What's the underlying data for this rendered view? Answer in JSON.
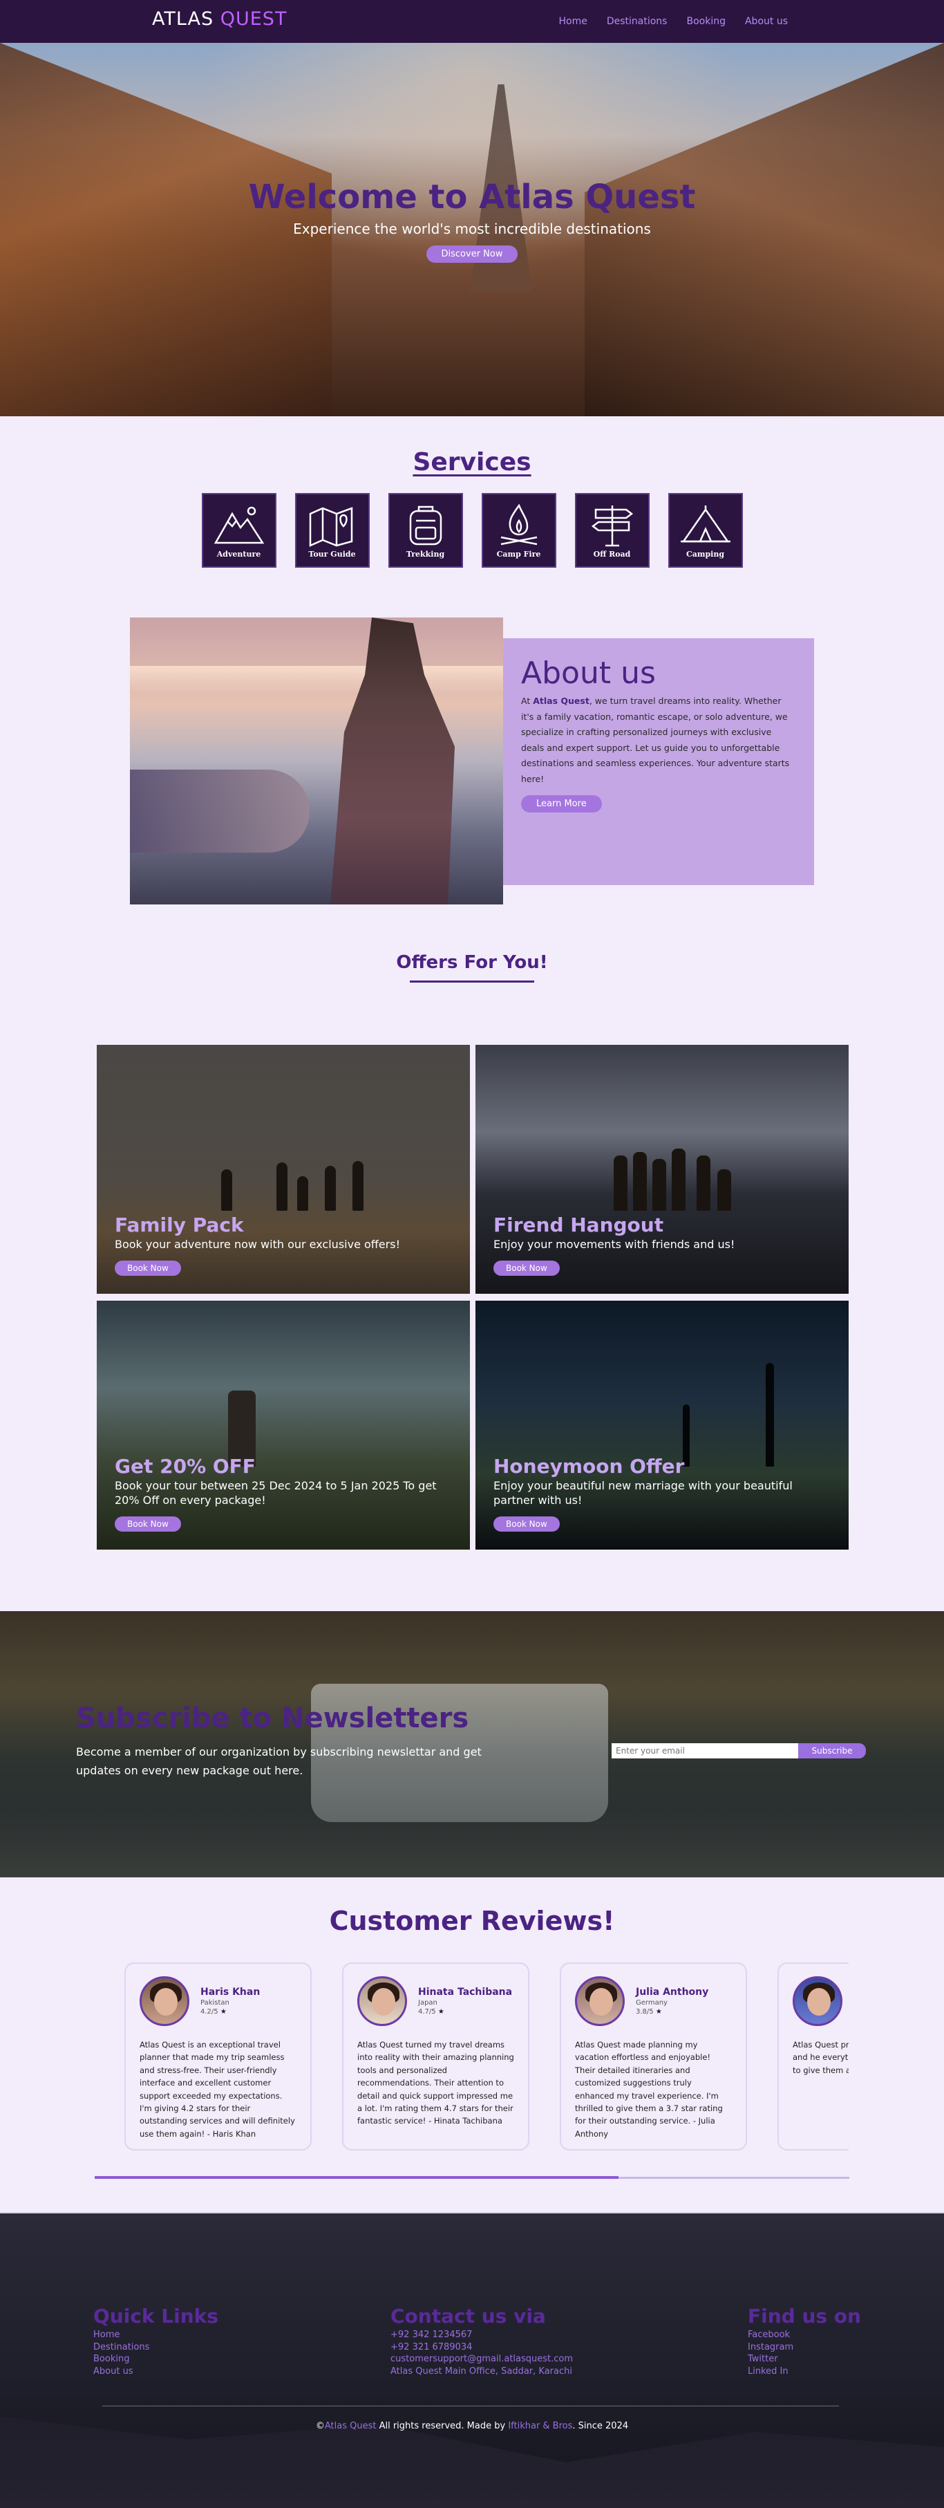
{
  "nav": {
    "logo_part1": "ATLAS ",
    "logo_part2": "QUEST",
    "links": [
      "Home",
      "Destinations",
      "Booking",
      "About us"
    ]
  },
  "hero": {
    "title": "Welcome to Atlas Quest",
    "subtitle": "Experience the world's most incredible destinations",
    "button": "Discover Now"
  },
  "services": {
    "title": "Services",
    "items": [
      {
        "label": "Adventure",
        "icon": "mountain-icon"
      },
      {
        "label": "Tour Guide",
        "icon": "map-icon"
      },
      {
        "label": "Trekking",
        "icon": "backpack-icon"
      },
      {
        "label": "Camp Fire",
        "icon": "campfire-icon"
      },
      {
        "label": "Off Road",
        "icon": "signpost-icon"
      },
      {
        "label": "Camping",
        "icon": "tent-icon"
      }
    ]
  },
  "about": {
    "title": "About us",
    "text_before": "At ",
    "brand": "Atlas Quest",
    "text_after": ", we turn travel dreams into reality. Whether it's a family vacation, romantic escape, or solo adventure, we specialize in crafting personalized journeys with exclusive deals and expert support. Let us guide you to unforgettable destinations and seamless experiences. Your adventure starts here!",
    "button": "Learn More"
  },
  "offers": {
    "title": "Offers For You!",
    "items": [
      {
        "title": "Family Pack",
        "desc": "Book your adventure now with our exclusive offers!",
        "button": "Book Now"
      },
      {
        "title": "Firend Hangout",
        "desc": "Enjoy your movements with friends and us!",
        "button": "Book Now"
      },
      {
        "title": "Get 20% OFF",
        "desc": "Book your tour between 25 Dec 2024 to 5 Jan 2025 To get 20% Off on every package!",
        "button": "Book Now"
      },
      {
        "title": "Honeymoon Offer",
        "desc": "Enjoy your beautiful new marriage with your beautiful partner with us!",
        "button": "Book Now"
      }
    ]
  },
  "newsletter": {
    "title": "Subscribe to Newsletters",
    "text": "Become a member of our organization by subscribing newslettar and get updates on every new package out here.",
    "placeholder": "Enter your email",
    "button": "Subscribe"
  },
  "reviews": {
    "title": "Customer Reviews!",
    "items": [
      {
        "name": "Haris Khan",
        "country": "Pakistan",
        "rating": "4.2/5",
        "text": "Atlas Quest is an exceptional travel planner that made my trip seamless and stress-free. Their user-friendly interface and excellent customer support exceeded my expectations. I'm giving 4.2 stars for their outstanding services and will definitely use them again! - Haris Khan"
      },
      {
        "name": "Hinata Tachibana",
        "country": "Japan",
        "rating": "4.7/5",
        "text": "Atlas Quest turned my travel dreams into reality with their amazing planning tools and personalized recommendations. Their attention to detail and quick support impressed me a lot. I'm rating them 4.7 stars for their fantastic service! - Hinata Tachibana"
      },
      {
        "name": "Julia Anthony",
        "country": "Germany",
        "rating": "3.8/5",
        "text": "Atlas Quest made planning my vacation effortless and enjoyable! Their detailed itineraries and customized suggestions truly enhanced my travel experience. I'm thrilled to give them a 3.7 star rating for their outstanding service. - Julia Anthony"
      },
      {
        "name": "",
        "country": "",
        "rating": "",
        "text": "Atlas Quest pro planning exper options and he everything was room for small to give them a their services! -"
      }
    ],
    "progress": 0.694
  },
  "footer": {
    "quick_links_title": "Quick Links",
    "quick_links": [
      "Home",
      "Destinations",
      "Booking",
      "About us"
    ],
    "contact_title": "Contact us via",
    "contacts": [
      "+92 342 1234567",
      "+92 321 6789034",
      "customersupport@gmail.atlasquest.com",
      "Atlas Quest Main Office, Saddar, Karachi"
    ],
    "find_title": "Find us on",
    "socials": [
      "Facebook",
      "Instagram",
      "Twitter",
      "Linked In"
    ],
    "copyright_symbol": "©",
    "copyright_brand": "Atlas Quest",
    "copyright_mid": " All rights reserved. Made by ",
    "copyright_maker": "Iftikhar & Bros",
    "copyright_end": ". Since 2024"
  }
}
